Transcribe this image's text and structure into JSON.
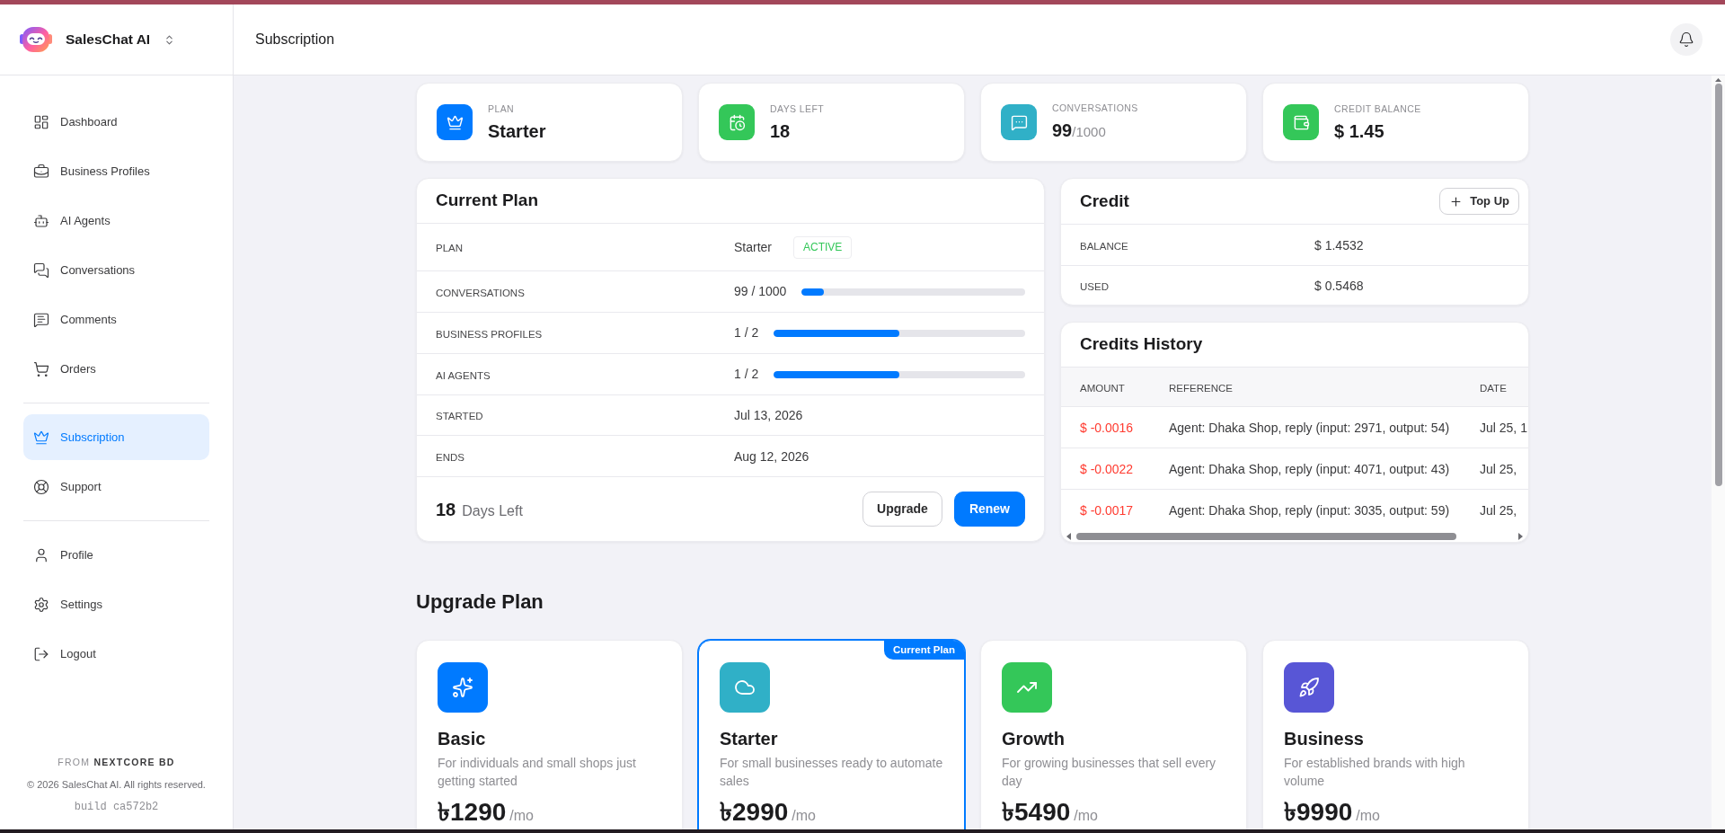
{
  "sidebar": {
    "app_name": "SalesChat AI",
    "sections": [
      {
        "items": [
          {
            "label": "Dashboard",
            "selected": false
          },
          {
            "label": "Business Profiles",
            "selected": false
          },
          {
            "label": "AI Agents",
            "selected": false
          },
          {
            "label": "Conversations",
            "selected": false
          },
          {
            "label": "Comments",
            "selected": false
          },
          {
            "label": "Orders",
            "selected": false
          }
        ]
      },
      {
        "items": [
          {
            "label": "Subscription",
            "selected": true
          },
          {
            "label": "Support",
            "selected": false
          }
        ]
      },
      {
        "items": [
          {
            "label": "Profile",
            "selected": false
          },
          {
            "label": "Settings",
            "selected": false
          },
          {
            "label": "Logout",
            "selected": false
          }
        ]
      }
    ],
    "footer": {
      "credit": "FROM **NEXTCORE BD**",
      "copyright": "© 2026 SalesChat AI. All rights reserved.",
      "build": "build ca572b2"
    }
  },
  "top_bar": {
    "title": "Subscription"
  },
  "stats": [
    {
      "label": "PLAN",
      "value": "Starter",
      "color": "#007aff"
    },
    {
      "label": "DAYS LEFT",
      "value": "18",
      "color": "#34c759"
    },
    {
      "label": "CONVERSATIONS",
      "value": "99",
      "suffix": "/1000",
      "color": "#30b0c7"
    },
    {
      "label": "CREDIT BALANCE",
      "value": "$ 1.45",
      "color": "#34c759"
    }
  ],
  "current_plan": {
    "title": "Current Plan",
    "rows": [
      {
        "kind": "badge",
        "label": "PLAN",
        "value": "Starter",
        "badge": "ACTIVE"
      },
      {
        "kind": "progress",
        "label": "CONVERSATIONS",
        "value": "99 / 1000",
        "level": 0.099
      },
      {
        "kind": "progress",
        "label": "BUSINESS PROFILES",
        "value": "1 / 2",
        "level": 0.5
      },
      {
        "kind": "progress",
        "label": "AI AGENTS",
        "value": "1 / 2",
        "level": 0.5
      },
      {
        "kind": "text",
        "label": "STARTED",
        "value": "Jul 13, 2026"
      },
      {
        "kind": "text",
        "label": "ENDS",
        "value": "Aug 12, 2026"
      }
    ],
    "days_left": "18",
    "days_left_label": "Days Left",
    "buttons": [
      {
        "label": "Upgrade",
        "kind": "outline"
      },
      {
        "label": "Renew",
        "kind": "primary"
      }
    ]
  },
  "credit": {
    "title": "Credit",
    "top_up": "Top Up",
    "rows": [
      {
        "label": "BALANCE",
        "value": "$ 1.4532"
      },
      {
        "label": "USED",
        "value": "$ 0.5468"
      }
    ]
  },
  "credits_history": {
    "title": "Credits History",
    "columns": [
      "AMOUNT",
      "REFERENCE",
      "DATE"
    ],
    "rows": [
      {
        "amount": "$ -0.0016",
        "reference": "Agent: Dhaka Shop, reply (input: 2971, output: 54)",
        "date": "Jul 25, 1"
      },
      {
        "amount": "$ -0.0022",
        "reference": "Agent: Dhaka Shop, reply (input: 4071, output: 43)",
        "date": "Jul 25,"
      },
      {
        "amount": "$ -0.0017",
        "reference": "Agent: Dhaka Shop, reply (input: 3035, output: 59)",
        "date": "Jul 25,"
      }
    ]
  },
  "upgrade_plan": {
    "title": "Upgrade Plan",
    "current_label": "Current Plan",
    "plans": [
      {
        "name": "Basic",
        "description": "For individuals and small shops just getting started",
        "price": "৳1290",
        "period": "/mo",
        "color": "#007aff",
        "current": false
      },
      {
        "name": "Starter",
        "description": "For small businesses ready to automate sales",
        "price": "৳2990",
        "period": "/mo",
        "color": "#30b0c7",
        "current": true
      },
      {
        "name": "Growth",
        "description": "For growing businesses that sell every day",
        "price": "৳5490",
        "period": "/mo",
        "color": "#34c759",
        "current": false
      },
      {
        "name": "Business",
        "description": "For established brands with high volume",
        "price": "৳9990",
        "period": "/mo",
        "color": "#5856d6",
        "current": false
      }
    ]
  }
}
